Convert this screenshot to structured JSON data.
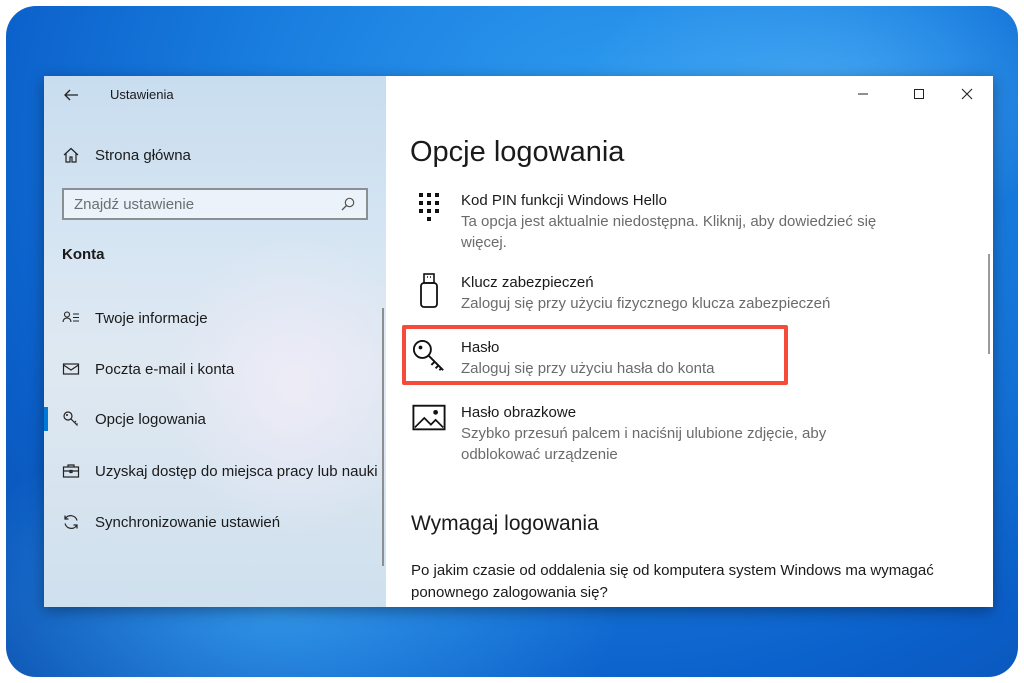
{
  "window": {
    "app_title": "Ustawienia",
    "controls": {
      "minimize": "—",
      "maximize": "☐",
      "close": "✕"
    }
  },
  "sidebar": {
    "home_label": "Strona główna",
    "search": {
      "placeholder": "Znajdź ustawienie",
      "value": ""
    },
    "section_heading": "Konta",
    "items": [
      {
        "label": "Twoje informacje",
        "icon": "user-info-icon"
      },
      {
        "label": "Poczta e-mail i konta",
        "icon": "mail-icon"
      },
      {
        "label": "Opcje logowania",
        "icon": "key-icon",
        "active": true
      },
      {
        "label": "Uzyskaj dostęp do miejsca pracy lub nauki",
        "icon": "briefcase-icon"
      },
      {
        "label": "Synchronizowanie ustawień",
        "icon": "sync-icon"
      }
    ]
  },
  "main": {
    "title": "Opcje logowania",
    "options": [
      {
        "title": "Kod PIN funkcji Windows Hello",
        "desc": "Ta opcja jest aktualnie niedostępna. Kliknij, aby dowiedzieć się więcej.",
        "icon": "pin-keypad-icon"
      },
      {
        "title": "Klucz zabezpieczeń",
        "desc": "Zaloguj się przy użyciu fizycznego klucza zabezpieczeń",
        "icon": "usb-key-icon"
      },
      {
        "title": "Hasło",
        "desc": "Zaloguj się przy użyciu hasła do konta",
        "icon": "password-key-icon",
        "highlighted": true
      },
      {
        "title": "Hasło obrazkowe",
        "desc": "Szybko przesuń palcem i naciśnij ulubione zdjęcie, aby odblokować urządzenie",
        "icon": "picture-icon"
      }
    ],
    "require_signin": {
      "title": "Wymagaj logowania",
      "text": "Po jakim czasie od oddalenia się od komputera system Windows ma wymagać ponownego zalogowania się?"
    }
  },
  "colors": {
    "accent": "#0078d7",
    "highlight_border": "#f44b3a",
    "desktop_blue": "#1a7fe0"
  }
}
